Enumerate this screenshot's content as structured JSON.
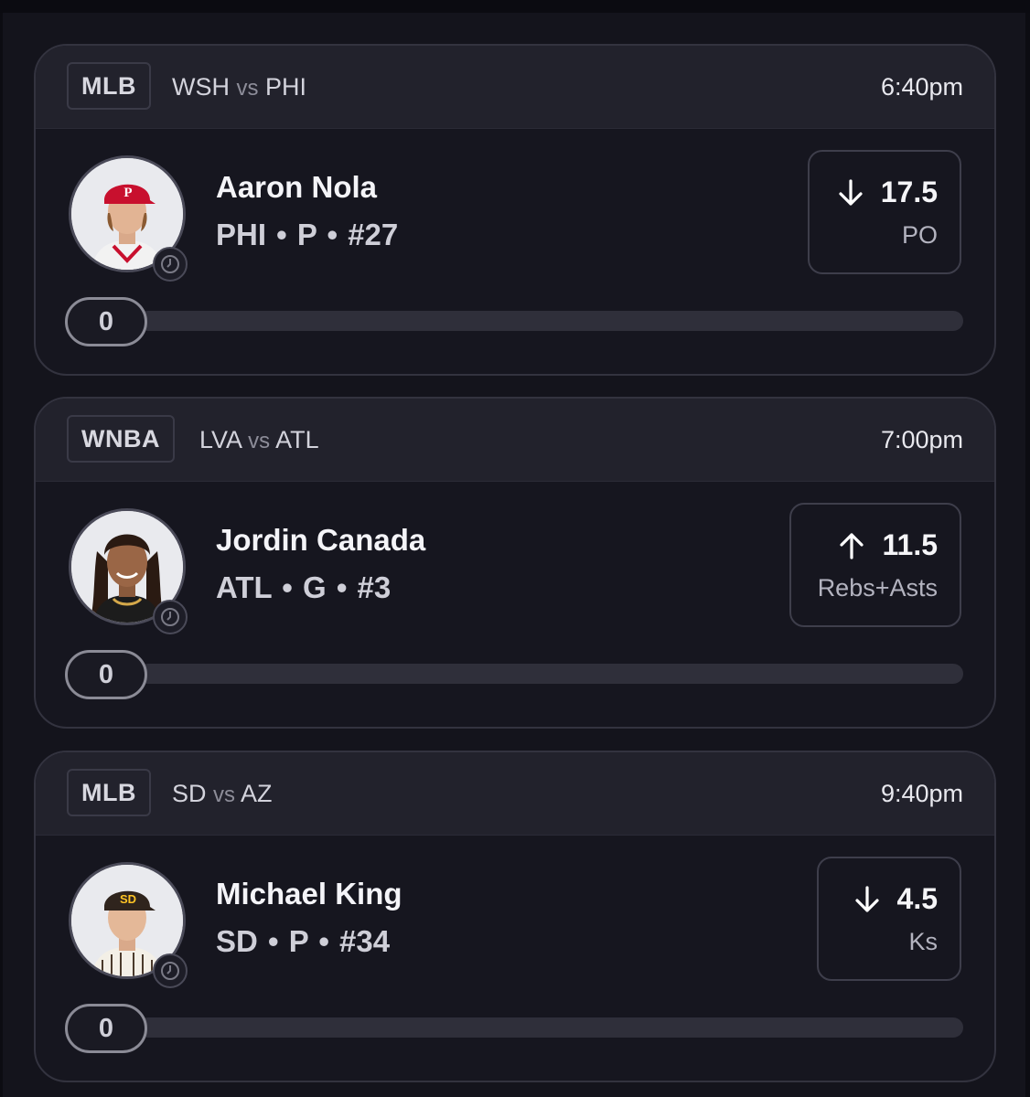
{
  "cards": [
    {
      "league": "MLB",
      "home": "WSH",
      "vs": "vs",
      "away": "PHI",
      "time": "6:40pm",
      "player": {
        "name": "Aaron Nola",
        "team": "PHI",
        "position": "P",
        "number": "#27",
        "meta": "PHI • P • #27",
        "hat_color": "#c8102e"
      },
      "line": "17.5",
      "direction": "down",
      "stat": "PO",
      "progress": "0",
      "progress_fraction": 0
    },
    {
      "league": "WNBA",
      "home": "LVA",
      "vs": "vs",
      "away": "ATL",
      "time": "7:00pm",
      "player": {
        "name": "Jordin Canada",
        "team": "ATL",
        "position": "G",
        "number": "#3",
        "meta": "ATL • G • #3",
        "hat_color": "#1a1a1a"
      },
      "line": "11.5",
      "direction": "up",
      "stat": "Rebs+Asts",
      "progress": "0",
      "progress_fraction": 0
    },
    {
      "league": "MLB",
      "home": "SD",
      "vs": "vs",
      "away": "AZ",
      "time": "9:40pm",
      "player": {
        "name": "Michael King",
        "team": "SD",
        "position": "P",
        "number": "#34",
        "meta": "SD • P • #34",
        "hat_color": "#2f241d"
      },
      "line": "4.5",
      "direction": "down",
      "stat": "Ks",
      "progress": "0",
      "progress_fraction": 0
    }
  ],
  "colors": {
    "background": "#14141c",
    "card": "#16161f",
    "header": "#22222c",
    "track": "#2f2f3a"
  },
  "icons": [
    "arrow-down-icon",
    "arrow-up-icon",
    "clock-icon"
  ]
}
